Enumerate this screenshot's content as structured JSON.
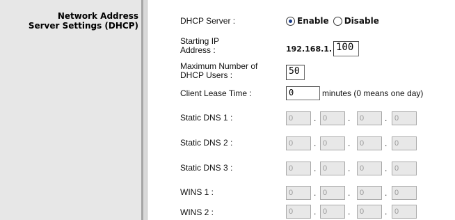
{
  "section": {
    "title_line1": "Network Address",
    "title_line2": "Server Settings (DHCP)"
  },
  "dhcp_server": {
    "label": "DHCP Server :",
    "enable_label": "Enable",
    "disable_label": "Disable",
    "selected": "Enable"
  },
  "starting_ip": {
    "label_line1": "Starting IP",
    "label_line2": "Address :",
    "prefix": "192.168.1.",
    "value": "100"
  },
  "max_users": {
    "label_line1": "Maximum Number of",
    "label_line2": "DHCP Users :",
    "value": "50"
  },
  "lease_time": {
    "label": "Client Lease Time :",
    "value": "0",
    "unit_text": "minutes (0 means one day)"
  },
  "ip_rows": [
    {
      "label": "Static DNS 1 :",
      "octets": [
        "0",
        "0",
        "0",
        "0"
      ]
    },
    {
      "label": "Static DNS 2 :",
      "octets": [
        "0",
        "0",
        "0",
        "0"
      ]
    },
    {
      "label": "Static DNS 3 :",
      "octets": [
        "0",
        "0",
        "0",
        "0"
      ]
    },
    {
      "label": "WINS 1 :",
      "octets": [
        "0",
        "0",
        "0",
        "0"
      ]
    },
    {
      "label": "WINS 2 :",
      "octets": [
        "0",
        "0",
        "0",
        "0"
      ]
    }
  ],
  "dot": "."
}
